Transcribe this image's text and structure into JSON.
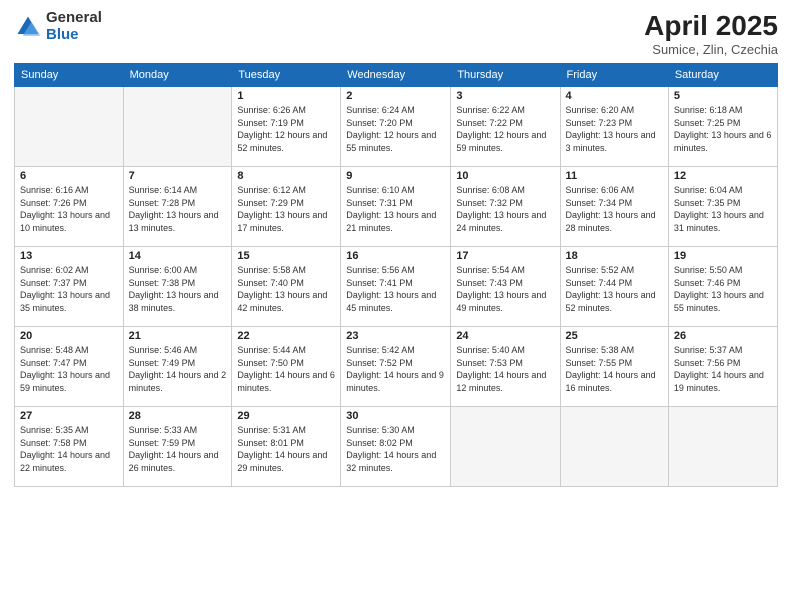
{
  "logo": {
    "general": "General",
    "blue": "Blue"
  },
  "title": {
    "month": "April 2025",
    "location": "Sumice, Zlin, Czechia"
  },
  "days_header": [
    "Sunday",
    "Monday",
    "Tuesday",
    "Wednesday",
    "Thursday",
    "Friday",
    "Saturday"
  ],
  "weeks": [
    [
      {
        "day": "",
        "info": ""
      },
      {
        "day": "",
        "info": ""
      },
      {
        "day": "1",
        "info": "Sunrise: 6:26 AM\nSunset: 7:19 PM\nDaylight: 12 hours and 52 minutes."
      },
      {
        "day": "2",
        "info": "Sunrise: 6:24 AM\nSunset: 7:20 PM\nDaylight: 12 hours and 55 minutes."
      },
      {
        "day": "3",
        "info": "Sunrise: 6:22 AM\nSunset: 7:22 PM\nDaylight: 12 hours and 59 minutes."
      },
      {
        "day": "4",
        "info": "Sunrise: 6:20 AM\nSunset: 7:23 PM\nDaylight: 13 hours and 3 minutes."
      },
      {
        "day": "5",
        "info": "Sunrise: 6:18 AM\nSunset: 7:25 PM\nDaylight: 13 hours and 6 minutes."
      }
    ],
    [
      {
        "day": "6",
        "info": "Sunrise: 6:16 AM\nSunset: 7:26 PM\nDaylight: 13 hours and 10 minutes."
      },
      {
        "day": "7",
        "info": "Sunrise: 6:14 AM\nSunset: 7:28 PM\nDaylight: 13 hours and 13 minutes."
      },
      {
        "day": "8",
        "info": "Sunrise: 6:12 AM\nSunset: 7:29 PM\nDaylight: 13 hours and 17 minutes."
      },
      {
        "day": "9",
        "info": "Sunrise: 6:10 AM\nSunset: 7:31 PM\nDaylight: 13 hours and 21 minutes."
      },
      {
        "day": "10",
        "info": "Sunrise: 6:08 AM\nSunset: 7:32 PM\nDaylight: 13 hours and 24 minutes."
      },
      {
        "day": "11",
        "info": "Sunrise: 6:06 AM\nSunset: 7:34 PM\nDaylight: 13 hours and 28 minutes."
      },
      {
        "day": "12",
        "info": "Sunrise: 6:04 AM\nSunset: 7:35 PM\nDaylight: 13 hours and 31 minutes."
      }
    ],
    [
      {
        "day": "13",
        "info": "Sunrise: 6:02 AM\nSunset: 7:37 PM\nDaylight: 13 hours and 35 minutes."
      },
      {
        "day": "14",
        "info": "Sunrise: 6:00 AM\nSunset: 7:38 PM\nDaylight: 13 hours and 38 minutes."
      },
      {
        "day": "15",
        "info": "Sunrise: 5:58 AM\nSunset: 7:40 PM\nDaylight: 13 hours and 42 minutes."
      },
      {
        "day": "16",
        "info": "Sunrise: 5:56 AM\nSunset: 7:41 PM\nDaylight: 13 hours and 45 minutes."
      },
      {
        "day": "17",
        "info": "Sunrise: 5:54 AM\nSunset: 7:43 PM\nDaylight: 13 hours and 49 minutes."
      },
      {
        "day": "18",
        "info": "Sunrise: 5:52 AM\nSunset: 7:44 PM\nDaylight: 13 hours and 52 minutes."
      },
      {
        "day": "19",
        "info": "Sunrise: 5:50 AM\nSunset: 7:46 PM\nDaylight: 13 hours and 55 minutes."
      }
    ],
    [
      {
        "day": "20",
        "info": "Sunrise: 5:48 AM\nSunset: 7:47 PM\nDaylight: 13 hours and 59 minutes."
      },
      {
        "day": "21",
        "info": "Sunrise: 5:46 AM\nSunset: 7:49 PM\nDaylight: 14 hours and 2 minutes."
      },
      {
        "day": "22",
        "info": "Sunrise: 5:44 AM\nSunset: 7:50 PM\nDaylight: 14 hours and 6 minutes."
      },
      {
        "day": "23",
        "info": "Sunrise: 5:42 AM\nSunset: 7:52 PM\nDaylight: 14 hours and 9 minutes."
      },
      {
        "day": "24",
        "info": "Sunrise: 5:40 AM\nSunset: 7:53 PM\nDaylight: 14 hours and 12 minutes."
      },
      {
        "day": "25",
        "info": "Sunrise: 5:38 AM\nSunset: 7:55 PM\nDaylight: 14 hours and 16 minutes."
      },
      {
        "day": "26",
        "info": "Sunrise: 5:37 AM\nSunset: 7:56 PM\nDaylight: 14 hours and 19 minutes."
      }
    ],
    [
      {
        "day": "27",
        "info": "Sunrise: 5:35 AM\nSunset: 7:58 PM\nDaylight: 14 hours and 22 minutes."
      },
      {
        "day": "28",
        "info": "Sunrise: 5:33 AM\nSunset: 7:59 PM\nDaylight: 14 hours and 26 minutes."
      },
      {
        "day": "29",
        "info": "Sunrise: 5:31 AM\nSunset: 8:01 PM\nDaylight: 14 hours and 29 minutes."
      },
      {
        "day": "30",
        "info": "Sunrise: 5:30 AM\nSunset: 8:02 PM\nDaylight: 14 hours and 32 minutes."
      },
      {
        "day": "",
        "info": ""
      },
      {
        "day": "",
        "info": ""
      },
      {
        "day": "",
        "info": ""
      }
    ]
  ]
}
